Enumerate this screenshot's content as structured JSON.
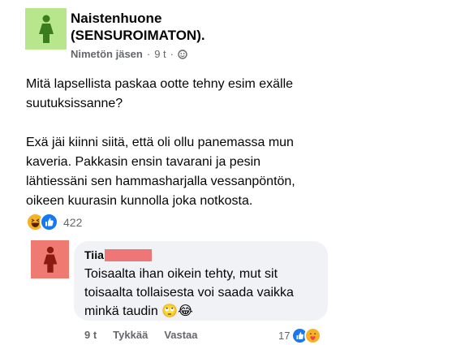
{
  "post": {
    "group_name": "Naistenhuone (SENSUROIMATON).",
    "author": "Nimetön jäsen",
    "time": "9 t",
    "separator": "·",
    "paragraph_1": "Mitä lapsellista paskaa ootte tehny esim exälle\nsuutuksissanne?",
    "paragraph_2": "Exä jäi kiinni siitä, että oli ollu panemassa mun\nkaveria. Pakkasin ensin tavarani ja pesin\nlähtiessäni sen hammasharjalla vessanpöntön,\noikeen kuurasin kunnolla joka notkosta.",
    "reaction_count": "422"
  },
  "comment": {
    "name": "Tiia",
    "text": "Toisaalta ihan oikein tehty, mut sit\ntoisaalta tollaisesta voi saada vaikka\nminkä taudin 🙄😂",
    "time": "9 t",
    "like_label": "Tykkää",
    "reply_label": "Vastaa",
    "reaction_count": "17"
  },
  "colors": {
    "group_avatar_bg": "#b8e68d",
    "comment_avatar_bg": "#ef7a72",
    "redaction": "#ee7676"
  }
}
